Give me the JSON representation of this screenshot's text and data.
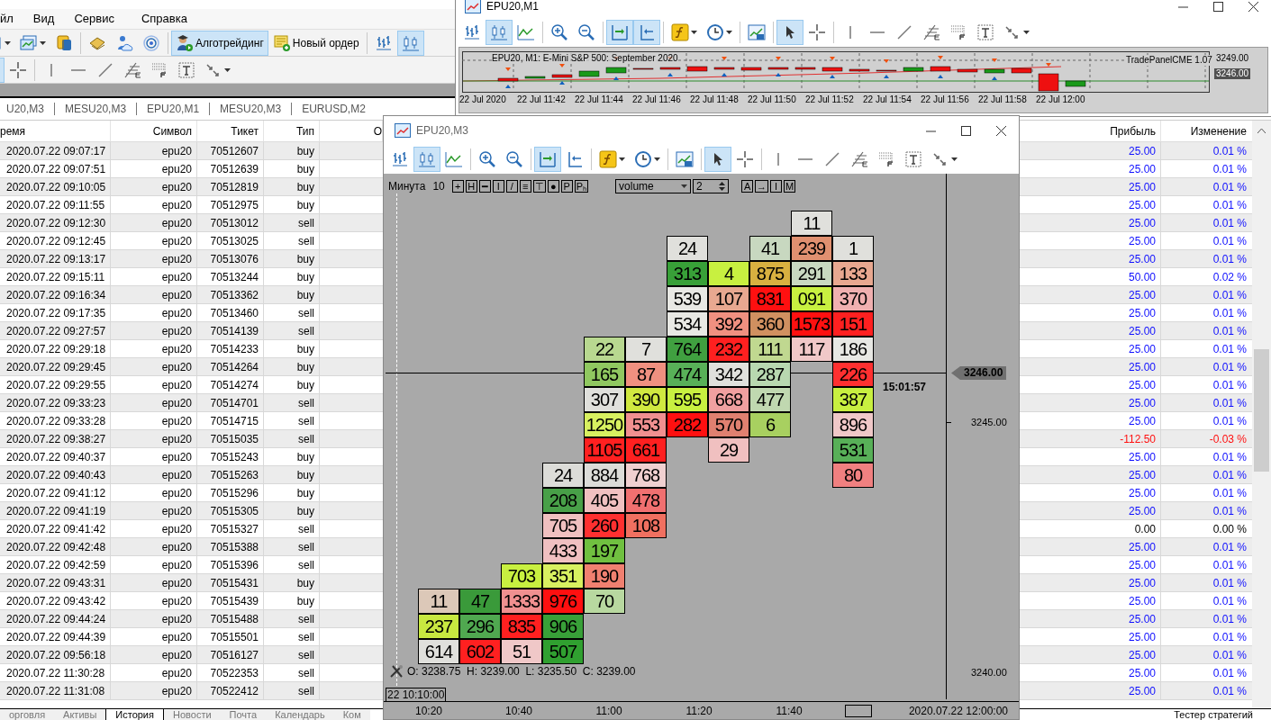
{
  "menu": [
    "йл",
    "Вид",
    "Сервис",
    "Справка"
  ],
  "toolbar_main": [
    [
      {
        "kind": "chart-new",
        "dropdown": true,
        "selected": false
      },
      {
        "kind": "profiles",
        "dropdown": true,
        "selected": false
      },
      {
        "kind": "dollar",
        "selected": false
      }
    ],
    [
      {
        "kind": "book",
        "selected": false
      },
      {
        "kind": "cloud",
        "selected": false
      },
      {
        "kind": "signal",
        "selected": false
      }
    ],
    [
      {
        "kind": "algo",
        "label": "Алготрейдинг",
        "selected": true
      },
      {
        "kind": "order",
        "label": "Новый ордер",
        "selected": false
      }
    ],
    [
      {
        "kind": "bars",
        "selected": false
      },
      {
        "kind": "candles",
        "selected": true
      }
    ]
  ],
  "toolbar_draw": [
    [
      {
        "kind": "cursor",
        "selected": true
      },
      {
        "kind": "crosshair",
        "selected": false
      }
    ],
    [
      {
        "kind": "vline",
        "selected": false
      },
      {
        "kind": "hline",
        "selected": false
      },
      {
        "kind": "trendline",
        "selected": false
      },
      {
        "kind": "fibo",
        "selected": false
      },
      {
        "kind": "grid",
        "selected": false
      },
      {
        "kind": "text",
        "selected": false
      },
      {
        "kind": "arrows",
        "dropdown": true,
        "selected": false
      }
    ]
  ],
  "chart_tabs": [
    "U20,M3",
    "MESU20,M3",
    "EPU20,M1",
    "MESU20,M3",
    "EURUSD,M2"
  ],
  "table": {
    "columns_left": [
      "ремя",
      "Символ",
      "Тикет",
      "Тип",
      "О"
    ],
    "columns_right": [
      "Прибыль",
      "Изменение"
    ],
    "rows": [
      {
        "time": "2020.07.22 09:07:17",
        "symbol": "epu20",
        "ticket": "70512607",
        "type": "buy",
        "profit": "25.00",
        "change": "0.01 %",
        "kind": "gain"
      },
      {
        "time": "2020.07.22 09:07:51",
        "symbol": "epu20",
        "ticket": "70512639",
        "type": "buy",
        "profit": "25.00",
        "change": "0.01 %",
        "kind": "gain"
      },
      {
        "time": "2020.07.22 09:10:05",
        "symbol": "epu20",
        "ticket": "70512819",
        "type": "buy",
        "profit": "25.00",
        "change": "0.01 %",
        "kind": "gain"
      },
      {
        "time": "2020.07.22 09:11:55",
        "symbol": "epu20",
        "ticket": "70512975",
        "type": "buy",
        "profit": "25.00",
        "change": "0.01 %",
        "kind": "gain"
      },
      {
        "time": "2020.07.22 09:12:30",
        "symbol": "epu20",
        "ticket": "70513012",
        "type": "sell",
        "profit": "25.00",
        "change": "0.01 %",
        "kind": "gain"
      },
      {
        "time": "2020.07.22 09:12:45",
        "symbol": "epu20",
        "ticket": "70513025",
        "type": "sell",
        "profit": "25.00",
        "change": "0.01 %",
        "kind": "gain"
      },
      {
        "time": "2020.07.22 09:13:17",
        "symbol": "epu20",
        "ticket": "70513076",
        "type": "buy",
        "profit": "25.00",
        "change": "0.01 %",
        "kind": "gain"
      },
      {
        "time": "2020.07.22 09:15:11",
        "symbol": "epu20",
        "ticket": "70513244",
        "type": "buy",
        "profit": "50.00",
        "change": "0.02 %",
        "kind": "gain"
      },
      {
        "time": "2020.07.22 09:16:34",
        "symbol": "epu20",
        "ticket": "70513362",
        "type": "buy",
        "profit": "25.00",
        "change": "0.01 %",
        "kind": "gain"
      },
      {
        "time": "2020.07.22 09:17:35",
        "symbol": "epu20",
        "ticket": "70513460",
        "type": "sell",
        "profit": "25.00",
        "change": "0.01 %",
        "kind": "gain"
      },
      {
        "time": "2020.07.22 09:27:57",
        "symbol": "epu20",
        "ticket": "70514139",
        "type": "sell",
        "profit": "25.00",
        "change": "0.01 %",
        "kind": "gain"
      },
      {
        "time": "2020.07.22 09:29:18",
        "symbol": "epu20",
        "ticket": "70514233",
        "type": "buy",
        "profit": "25.00",
        "change": "0.01 %",
        "kind": "gain"
      },
      {
        "time": "2020.07.22 09:29:45",
        "symbol": "epu20",
        "ticket": "70514264",
        "type": "buy",
        "profit": "25.00",
        "change": "0.01 %",
        "kind": "gain"
      },
      {
        "time": "2020.07.22 09:29:55",
        "symbol": "epu20",
        "ticket": "70514274",
        "type": "buy",
        "profit": "25.00",
        "change": "0.01 %",
        "kind": "gain"
      },
      {
        "time": "2020.07.22 09:33:23",
        "symbol": "epu20",
        "ticket": "70514701",
        "type": "sell",
        "profit": "25.00",
        "change": "0.01 %",
        "kind": "gain"
      },
      {
        "time": "2020.07.22 09:33:28",
        "symbol": "epu20",
        "ticket": "70514715",
        "type": "sell",
        "profit": "25.00",
        "change": "0.01 %",
        "kind": "gain"
      },
      {
        "time": "2020.07.22 09:38:27",
        "symbol": "epu20",
        "ticket": "70515035",
        "type": "sell",
        "profit": "-112.50",
        "change": "-0.03 %",
        "kind": "loss"
      },
      {
        "time": "2020.07.22 09:40:37",
        "symbol": "epu20",
        "ticket": "70515243",
        "type": "buy",
        "profit": "25.00",
        "change": "0.01 %",
        "kind": "gain"
      },
      {
        "time": "2020.07.22 09:40:43",
        "symbol": "epu20",
        "ticket": "70515263",
        "type": "buy",
        "profit": "25.00",
        "change": "0.01 %",
        "kind": "gain"
      },
      {
        "time": "2020.07.22 09:41:12",
        "symbol": "epu20",
        "ticket": "70515296",
        "type": "buy",
        "profit": "25.00",
        "change": "0.01 %",
        "kind": "gain"
      },
      {
        "time": "2020.07.22 09:41:19",
        "symbol": "epu20",
        "ticket": "70515305",
        "type": "buy",
        "profit": "25.00",
        "change": "0.01 %",
        "kind": "gain"
      },
      {
        "time": "2020.07.22 09:41:42",
        "symbol": "epu20",
        "ticket": "70515327",
        "type": "sell",
        "profit": "0.00",
        "change": "0.00 %",
        "kind": "flat"
      },
      {
        "time": "2020.07.22 09:42:48",
        "symbol": "epu20",
        "ticket": "70515388",
        "type": "sell",
        "profit": "25.00",
        "change": "0.01 %",
        "kind": "gain"
      },
      {
        "time": "2020.07.22 09:42:59",
        "symbol": "epu20",
        "ticket": "70515396",
        "type": "sell",
        "profit": "25.00",
        "change": "0.01 %",
        "kind": "gain"
      },
      {
        "time": "2020.07.22 09:43:31",
        "symbol": "epu20",
        "ticket": "70515431",
        "type": "buy",
        "profit": "25.00",
        "change": "0.01 %",
        "kind": "gain"
      },
      {
        "time": "2020.07.22 09:43:42",
        "symbol": "epu20",
        "ticket": "70515439",
        "type": "buy",
        "profit": "25.00",
        "change": "0.01 %",
        "kind": "gain"
      },
      {
        "time": "2020.07.22 09:44:24",
        "symbol": "epu20",
        "ticket": "70515488",
        "type": "sell",
        "profit": "25.00",
        "change": "0.01 %",
        "kind": "gain"
      },
      {
        "time": "2020.07.22 09:44:39",
        "symbol": "epu20",
        "ticket": "70515501",
        "type": "sell",
        "profit": "25.00",
        "change": "0.01 %",
        "kind": "gain"
      },
      {
        "time": "2020.07.22 09:56:18",
        "symbol": "epu20",
        "ticket": "70516127",
        "type": "sell",
        "profit": "25.00",
        "change": "0.01 %",
        "kind": "gain"
      },
      {
        "time": "2020.07.22 11:30:28",
        "symbol": "epu20",
        "ticket": "70522353",
        "type": "sell",
        "profit": "25.00",
        "change": "0.01 %",
        "kind": "gain"
      },
      {
        "time": "2020.07.22 11:31:08",
        "symbol": "epu20",
        "ticket": "70522412",
        "type": "sell",
        "profit": "25.00",
        "change": "0.01 %",
        "kind": "gain"
      }
    ]
  },
  "bottom_tabs": [
    {
      "label": "орговля",
      "selected": false
    },
    {
      "label": "Активы",
      "selected": false
    },
    {
      "label": "История",
      "selected": true
    },
    {
      "label": "Новости",
      "selected": false
    },
    {
      "label": "Почта",
      "selected": false
    },
    {
      "label": "Календарь",
      "selected": false
    },
    {
      "label": "Ком",
      "selected": false
    }
  ],
  "tester_tab": "Тестер стратегий",
  "mini_window": {
    "title": "EPU20,M1",
    "toolbar": [
      [
        {
          "kind": "bars",
          "selected": false
        },
        {
          "kind": "candles",
          "selected": true
        },
        {
          "kind": "line",
          "selected": false
        }
      ],
      [
        {
          "kind": "zoom-in",
          "selected": false
        },
        {
          "kind": "zoom-out",
          "selected": false
        }
      ],
      [
        {
          "kind": "autoscroll",
          "selected": true
        },
        {
          "kind": "shift",
          "selected": true
        }
      ],
      [
        {
          "kind": "indicators",
          "dropdown": true,
          "selected": false
        },
        {
          "kind": "period",
          "dropdown": true,
          "selected": false
        }
      ],
      [
        {
          "kind": "templates",
          "selected": false
        }
      ],
      [
        {
          "kind": "cursor",
          "selected": true
        },
        {
          "kind": "crosshair",
          "selected": false
        }
      ],
      [
        {
          "kind": "vline",
          "selected": false
        },
        {
          "kind": "hline",
          "selected": false
        },
        {
          "kind": "trendline",
          "selected": false
        },
        {
          "kind": "fibo",
          "selected": false
        },
        {
          "kind": "grid",
          "selected": false
        },
        {
          "kind": "text",
          "selected": false
        },
        {
          "kind": "arrows",
          "dropdown": true,
          "selected": false
        }
      ]
    ],
    "caption": "EPU20, M1:  E-Mini S&P 500: September 2020",
    "panel": "TradePanelCME 1.07",
    "price_labels": [
      {
        "text": "3249.00",
        "kind": "level"
      },
      {
        "text": "3246.00",
        "kind": "current"
      }
    ],
    "time_labels": [
      "22 Jul 2020",
      "22 Jul 11:42",
      "22 Jul 11:44",
      "22 Jul 11:46",
      "22 Jul 11:48",
      "22 Jul 11:50",
      "22 Jul 11:52",
      "22 Jul 11:54",
      "22 Jul 11:56",
      "22 Jul 11:58",
      "22 Jul 12:00"
    ]
  },
  "chart_window": {
    "title": "EPU20,M3",
    "toolbar": [
      [
        {
          "kind": "bars",
          "selected": false
        },
        {
          "kind": "candles",
          "selected": true
        },
        {
          "kind": "line",
          "selected": false
        }
      ],
      [
        {
          "kind": "zoom-in",
          "selected": false
        },
        {
          "kind": "zoom-out",
          "selected": false
        }
      ],
      [
        {
          "kind": "autoscroll",
          "selected": true
        },
        {
          "kind": "shift",
          "selected": false
        }
      ],
      [
        {
          "kind": "indicators",
          "dropdown": true,
          "selected": false
        },
        {
          "kind": "period",
          "dropdown": true,
          "selected": false
        }
      ],
      [
        {
          "kind": "templates",
          "selected": false
        }
      ],
      [
        {
          "kind": "cursor",
          "selected": true
        },
        {
          "kind": "crosshair",
          "selected": false
        }
      ],
      [
        {
          "kind": "vline",
          "selected": false
        },
        {
          "kind": "hline",
          "selected": false
        },
        {
          "kind": "trendline",
          "selected": false
        },
        {
          "kind": "fibo",
          "selected": false
        },
        {
          "kind": "grid",
          "selected": false
        },
        {
          "kind": "text",
          "selected": false
        },
        {
          "kind": "arrows",
          "dropdown": true,
          "selected": false
        }
      ]
    ],
    "panel": {
      "period": "Минута",
      "count": "10",
      "buttons": [
        "+",
        "H",
        "━",
        "I",
        "/",
        "≡",
        "⊤",
        "●",
        "P",
        "Pₕ"
      ],
      "mode": "volume",
      "step": "2",
      "buttons2": [
        "A",
        "→",
        "I",
        "M"
      ]
    },
    "footprint": {
      "columns": [
        [
          null,
          null,
          null,
          null,
          null,
          null,
          null,
          null,
          null,
          null,
          null,
          null,
          null,
          null,
          null,
          {
            "value": "11",
            "color": "#dcc8b8"
          },
          {
            "value": "237",
            "color": "#c8e840"
          },
          {
            "value": "614",
            "color": "#e0e0dc"
          }
        ],
        [
          null,
          null,
          null,
          null,
          null,
          null,
          null,
          null,
          null,
          null,
          null,
          null,
          null,
          null,
          null,
          {
            "value": "47",
            "color": "#3a9a3a"
          },
          {
            "value": "296",
            "color": "#50a850"
          },
          {
            "value": "602",
            "color": "#ff2020"
          }
        ],
        [
          null,
          null,
          null,
          null,
          null,
          null,
          null,
          null,
          null,
          null,
          null,
          null,
          null,
          null,
          {
            "value": "703",
            "color": "#c8f040"
          },
          {
            "value": "1333",
            "color": "#f09090"
          },
          {
            "value": "835",
            "color": "#ff2020"
          },
          {
            "value": "51",
            "color": "#f0c8c8"
          }
        ],
        [
          null,
          null,
          null,
          null,
          null,
          null,
          null,
          null,
          null,
          null,
          {
            "value": "24",
            "color": "#dcdcd8"
          },
          {
            "value": "208",
            "color": "#48a048"
          },
          {
            "value": "705",
            "color": "#f0c0c0"
          },
          {
            "value": "433",
            "color": "#f0c0c1"
          },
          {
            "value": "351",
            "color": "#d8f060"
          },
          {
            "value": "976",
            "color": "#ff1010"
          },
          {
            "value": "906",
            "color": "#38a038"
          },
          {
            "value": "507",
            "color": "#30a030"
          }
        ],
        [
          null,
          null,
          null,
          null,
          null,
          {
            "value": "22",
            "color": "#b8d890"
          },
          {
            "value": "165",
            "color": "#90c860"
          },
          {
            "value": "307",
            "color": "#e0e0dc"
          },
          {
            "value": "1250",
            "color": "#d8f060"
          },
          {
            "value": "1105",
            "color": "#ff2020"
          },
          {
            "value": "884",
            "color": "#dcdcd8"
          },
          {
            "value": "405",
            "color": "#f0c0c0"
          },
          {
            "value": "260",
            "color": "#ff3030"
          },
          {
            "value": "197",
            "color": "#70c040"
          },
          {
            "value": "190",
            "color": "#f08070"
          },
          {
            "value": "70",
            "color": "#b8d8a0"
          }
        ],
        [
          null,
          null,
          null,
          null,
          null,
          {
            "value": "7",
            "color": "#e0e0dc"
          },
          {
            "value": "87",
            "color": "#f09080"
          },
          {
            "value": "390",
            "color": "#d0e840"
          },
          {
            "value": "553",
            "color": "#f09090"
          },
          {
            "value": "661",
            "color": "#ff2020"
          },
          {
            "value": "768",
            "color": "#f0d0d0"
          },
          {
            "value": "478",
            "color": "#f07070"
          },
          {
            "value": "108",
            "color": "#f07060"
          }
        ],
        [
          null,
          {
            "value": "24",
            "color": "#e0e0dc"
          },
          {
            "value": "313",
            "color": "#38a038"
          },
          {
            "value": "539",
            "color": "#e8e8e4"
          },
          {
            "value": "534",
            "color": "#e8e8e4"
          },
          {
            "value": "764",
            "color": "#40a040"
          },
          {
            "value": "474",
            "color": "#58b058"
          },
          {
            "value": "595",
            "color": "#c8f040"
          },
          {
            "value": "282",
            "color": "#ff1010"
          }
        ],
        [
          null,
          null,
          {
            "value": "4",
            "color": "#c8f040"
          },
          {
            "value": "107",
            "color": "#e8a890"
          },
          {
            "value": "392",
            "color": "#f09080"
          },
          {
            "value": "232",
            "color": "#ff2020"
          },
          {
            "value": "342",
            "color": "#e0e0dc"
          },
          {
            "value": "668",
            "color": "#f0a0a0"
          },
          {
            "value": "570",
            "color": "#e08070"
          },
          {
            "value": "29",
            "color": "#f0c0c0"
          }
        ],
        [
          null,
          {
            "value": "41",
            "color": "#c8d8c0"
          },
          {
            "value": "875",
            "color": "#d8b040"
          },
          {
            "value": "831",
            "color": "#ff1010"
          },
          {
            "value": "360",
            "color": "#d09060"
          },
          {
            "value": "111",
            "color": "#c0d890"
          },
          {
            "value": "287",
            "color": "#b8d8b0"
          },
          {
            "value": "477",
            "color": "#c0d8b0"
          },
          {
            "value": "6",
            "color": "#a8d060"
          }
        ],
        [
          {
            "value": "11",
            "color": "#e0e0dc"
          },
          {
            "value": "239",
            "color": "#e09070"
          },
          {
            "value": "291",
            "color": "#c8d8c0"
          },
          {
            "value": "091",
            "color": "#c8f040"
          },
          {
            "value": "1573",
            "color": "#ff1010"
          },
          {
            "value": "117",
            "color": "#f0c8c8"
          }
        ],
        [
          null,
          {
            "value": "1",
            "color": "#e0e0dc"
          },
          {
            "value": "133",
            "color": "#e8a890"
          },
          {
            "value": "370",
            "color": "#f0b0b0"
          },
          {
            "value": "151",
            "color": "#ff2020"
          },
          {
            "value": "186",
            "color": "#e8e8e4"
          },
          {
            "value": "226",
            "color": "#ff3030"
          },
          {
            "value": "387",
            "color": "#c8f040"
          },
          {
            "value": "896",
            "color": "#f0c8c8"
          },
          {
            "value": "531",
            "color": "#58b058"
          },
          {
            "value": "80",
            "color": "#f08080"
          }
        ]
      ]
    },
    "crosshair_price": "3246.00",
    "countdown": "15:01:57",
    "price_labels": [
      "3245.00",
      "3240.00"
    ],
    "ohlc": "O: 3238.75  H: 3239.00  L: 3235.50  C: 3239.00",
    "crosshair_time": "22 10:10:00",
    "time_labels": [
      "10:20",
      "10:40",
      "11:00",
      "11:20",
      "11:40"
    ],
    "time_end": "2020.07.22 12:00:00"
  }
}
